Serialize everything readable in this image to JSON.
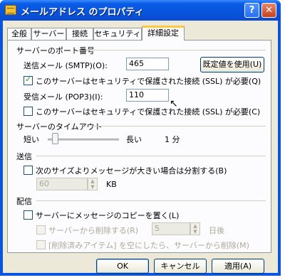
{
  "window": {
    "title": "メールアドレス のプロパティ",
    "help_label": "?",
    "close_label": "✕"
  },
  "tabs": [
    "全般",
    "サーバー",
    "接続",
    "セキュリティ",
    "詳細設定"
  ],
  "ports": {
    "heading": "サーバーのポート番号",
    "smtp_label": "送信メール (SMTP)(O):",
    "smtp_value": "465",
    "default_button": "既定値を使用(U)",
    "smtp_ssl_label": "このサーバーはセキュリティで保護された接続 (SSL) が必要(Q)",
    "smtp_ssl_checked": true,
    "pop3_label": "受信メール (POP3)(I):",
    "pop3_value": "110",
    "pop3_ssl_label": "このサーバーはセキュリティで保護された接続 (SSL) が必要(C)",
    "pop3_ssl_checked": false
  },
  "timeout": {
    "heading": "サーバーのタイムアウト",
    "short_label": "短い",
    "long_label": "長い",
    "value": "1 分",
    "level": 0.1
  },
  "send": {
    "heading": "送信",
    "split_label": "次のサイズよりメッセージが大きい場合は分割する(B)",
    "size_value": "60",
    "unit": "KB"
  },
  "delivery": {
    "heading": "配信",
    "leave_copy_label": "サーバーにメッセージのコピーを置く(L)",
    "remove_after_label": "サーバーから削除する(R)",
    "days_value": "5",
    "days_unit": "日後",
    "remove_deleted_label": "[削除済みアイテム] を空にしたら、サーバーから削除(M)"
  },
  "footer": {
    "ok": "OK",
    "cancel": "キャンセル",
    "apply": "適用(A)"
  }
}
